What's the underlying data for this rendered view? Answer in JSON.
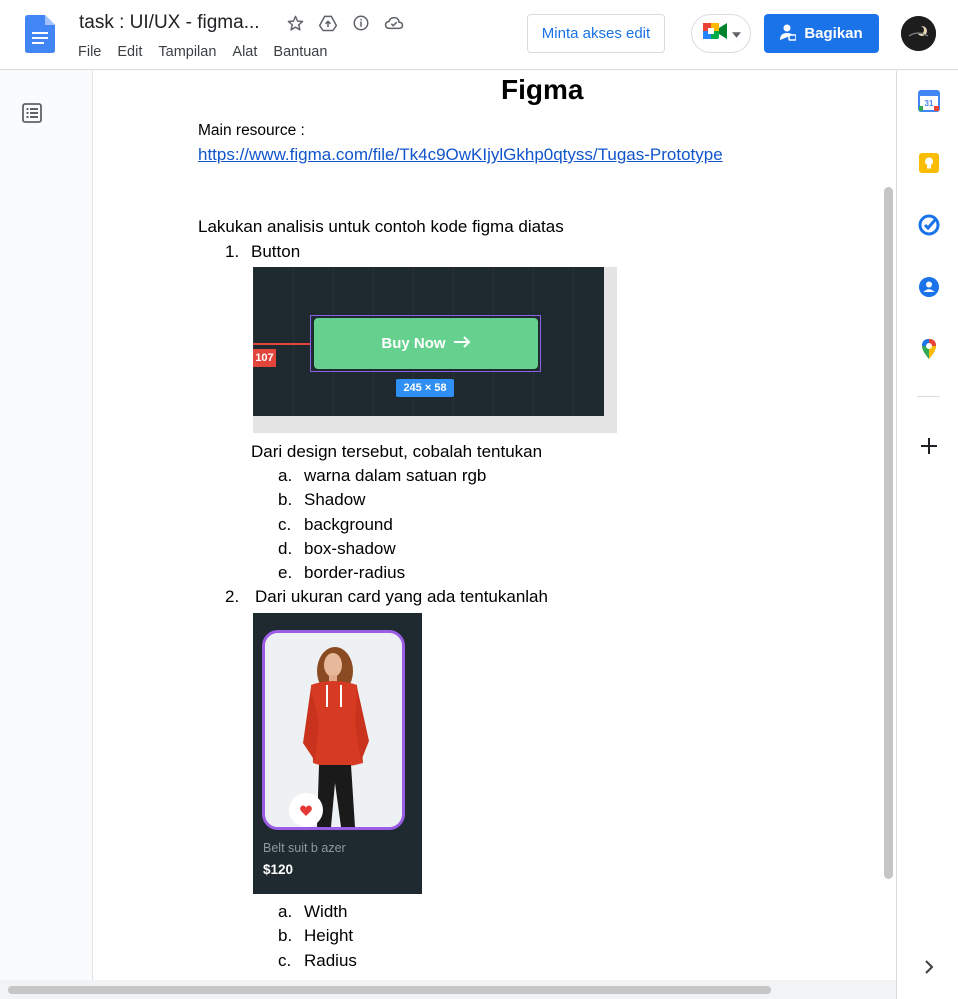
{
  "header": {
    "doc_title": "task : UI/UX - figma...",
    "menu": [
      "File",
      "Edit",
      "Tampilan",
      "Alat",
      "Bantuan"
    ],
    "request_edit_label": "Minta akses edit",
    "share_label": "Bagikan",
    "title_icons": [
      "star-icon",
      "move-to-drive-icon",
      "details-icon",
      "cloud-status-icon"
    ]
  },
  "document": {
    "title": "Figma",
    "main_resource_label": "Main resource :",
    "link": "https://www.figma.com/file/Tk4c9OwKIjylGkhp0qtyss/Tugas-Prototype",
    "intro": "Lakukan analisis untuk contoh kode figma diatas",
    "item1": {
      "number": "1.",
      "label": "Button"
    },
    "button_image": {
      "left_tag": "107",
      "button_text": "Buy Now",
      "size_tag": "245 × 58"
    },
    "item1_text": "Dari design tersebut, cobalah tentukan",
    "item1_sub": [
      {
        "letter": "a.",
        "text": "warna dalam satuan rgb"
      },
      {
        "letter": "b.",
        "text": "Shadow"
      },
      {
        "letter": "c.",
        "text": "background"
      },
      {
        "letter": "d.",
        "text": "box-shadow"
      },
      {
        "letter": "e.",
        "text": "border-radius"
      }
    ],
    "item2": {
      "number": "2.",
      "label": "Dari ukuran card yang ada tentukanlah"
    },
    "card_image": {
      "name": "Belt suit b azer",
      "price": "$120"
    },
    "item2_sub": [
      {
        "letter": "a.",
        "text": "Width"
      },
      {
        "letter": "b.",
        "text": "Height"
      },
      {
        "letter": "c.",
        "text": "Radius"
      }
    ]
  },
  "sidepanel": [
    "calendar-icon",
    "keep-icon",
    "tasks-icon",
    "contacts-icon",
    "maps-icon",
    "add-icon",
    "chevron-right-icon"
  ],
  "colors": {
    "primary": "#1a73e8",
    "button_green": "#66d08e",
    "card_outline": "#9b5de5",
    "dark_bg": "#1f2a30"
  }
}
